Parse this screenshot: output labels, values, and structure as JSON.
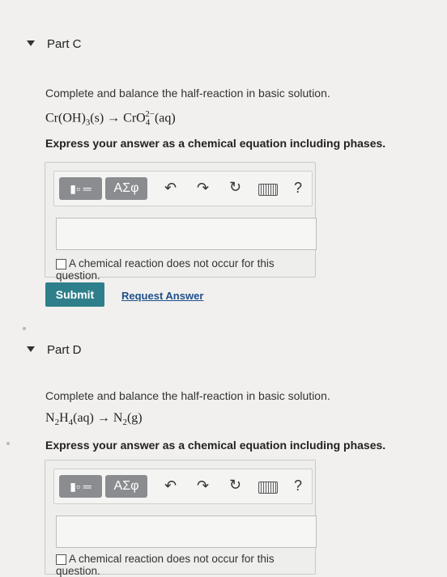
{
  "part_c": {
    "title": "Part C",
    "prompt": "Complete and balance the half-reaction in basic solution.",
    "equation": {
      "reactant": "Cr(OH)",
      "reactant_sub": "3",
      "reactant_phase": "(s)",
      "arrow": "→",
      "product": "CrO",
      "product_sub": "4",
      "product_sup": "2−",
      "product_phase": "(aq)"
    },
    "instruction": "Express your answer as a chemical equation including phases.",
    "toolbar": {
      "greek_label": "ΑΣφ",
      "help_label": "?"
    },
    "answer_value": "",
    "no_reaction_label": "A chemical reaction does not occur for this question.",
    "submit_label": "Submit",
    "request_label": "Request Answer"
  },
  "part_d": {
    "title": "Part D",
    "prompt": "Complete and balance the half-reaction in basic solution.",
    "equation": {
      "r1": "N",
      "r1_sub": "2",
      "r2": "H",
      "r2_sub": "4",
      "reactant_phase": "(aq)",
      "arrow": "→",
      "product": "N",
      "product_sub": "2",
      "product_phase": "(g)"
    },
    "instruction": "Express your answer as a chemical equation including phases.",
    "toolbar": {
      "greek_label": "ΑΣφ",
      "help_label": "?"
    },
    "answer_value": "",
    "no_reaction_label": "A chemical reaction does not occur for this question."
  },
  "icons": [
    "collapse-caret-icon",
    "templates-icon",
    "undo-icon",
    "redo-icon",
    "reset-icon",
    "keyboard-icon",
    "help-icon"
  ]
}
